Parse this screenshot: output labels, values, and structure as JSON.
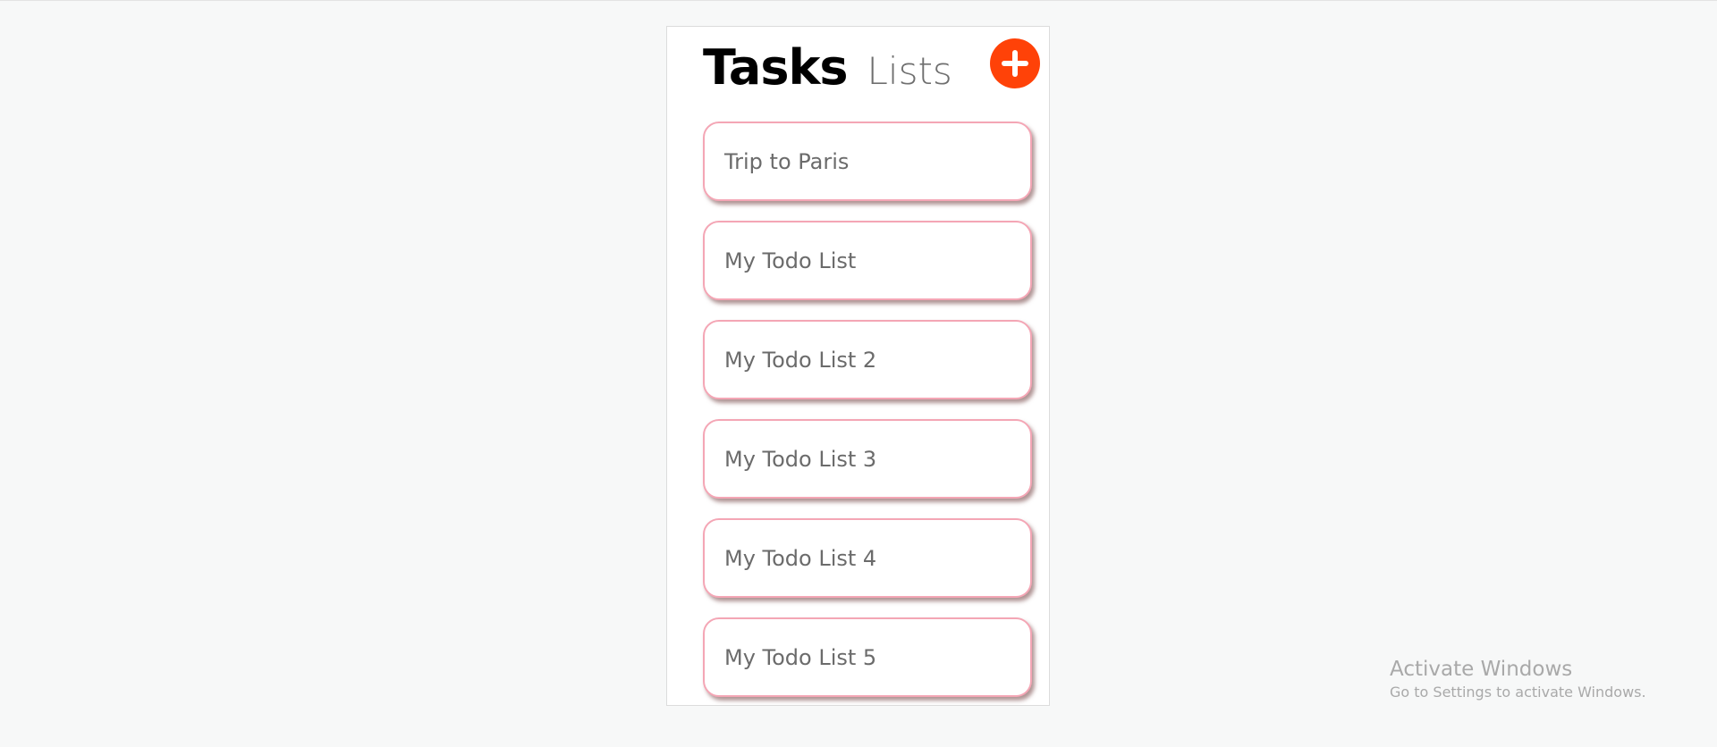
{
  "header": {
    "tasks_tab": "Tasks",
    "lists_tab": "Lists"
  },
  "add_button": {
    "icon": "plus-icon",
    "color": "#ff4208"
  },
  "lists": [
    {
      "label": "Trip to Paris"
    },
    {
      "label": "My Todo List"
    },
    {
      "label": "My Todo List 2"
    },
    {
      "label": "My Todo List 3"
    },
    {
      "label": "My Todo List 4"
    },
    {
      "label": "My Todo List 5"
    }
  ],
  "watermark": {
    "title": "Activate Windows",
    "subtitle": "Go to Settings to activate Windows."
  },
  "colors": {
    "card_border": "#f4a6b5",
    "accent": "#ff4208",
    "background": "#f7f8f8"
  }
}
